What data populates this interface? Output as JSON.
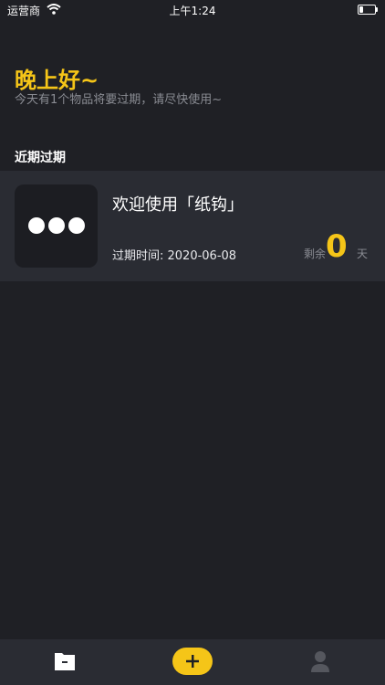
{
  "status_bar": {
    "carrier": "运营商",
    "time": "上午1:24"
  },
  "header": {
    "greeting": "晚上好~",
    "subtitle": "今天有1个物品将要过期，请尽快使用~"
  },
  "section": {
    "title": "近期过期"
  },
  "items": [
    {
      "title": "欢迎使用「纸钩」",
      "expire_text": "过期时间: 2020-06-08",
      "remaining_label": "剩余",
      "remaining_days": "0",
      "day_unit": "天",
      "thumbnail_icon": "more-dots-icon"
    }
  ],
  "tabbar": {
    "tabs": [
      {
        "icon": "folder-icon"
      },
      {
        "icon": "add-icon"
      },
      {
        "icon": "profile-icon"
      }
    ]
  },
  "colors": {
    "background": "#1f2025",
    "card": "#2a2c33",
    "accent": "#f5c518"
  }
}
